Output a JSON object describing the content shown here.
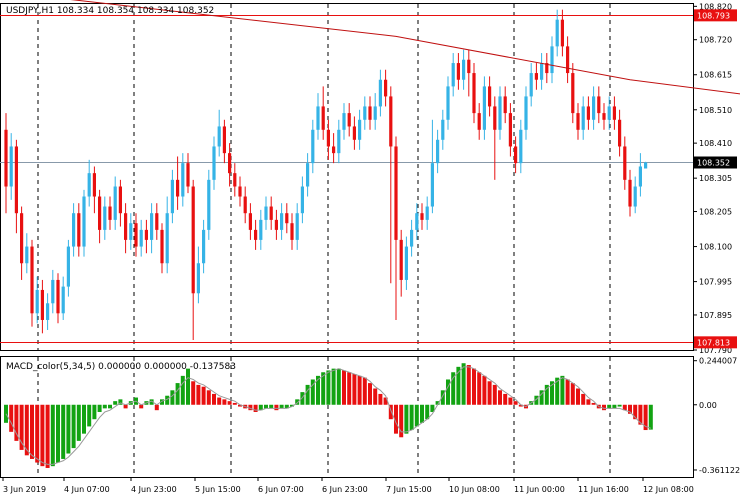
{
  "header": {
    "symbol_line": "USDJPY,H1  108.334 108.354 108.334 108.352"
  },
  "indicator": {
    "label": "MACD_color(5,34,5) 0.000000 0.000000 -0.137583"
  },
  "colors": {
    "bull": "#35B3E6",
    "bear": "#E81010",
    "macd_pos": "#12A312",
    "macd_neg": "#E81010",
    "signal": "#9A9A9A",
    "level_line": "#E81010",
    "ma_line": "#C01010",
    "current_price_line": "#8899AA",
    "grid": "#000000",
    "price_label_bg": "#E81010",
    "current_label_bg": "#000000"
  },
  "chart_data": [
    {
      "type": "candlestick",
      "title": "",
      "ylim": [
        107.79,
        108.83
      ],
      "y_ticks": [
        "108.820",
        "108.720",
        "108.615",
        "108.510",
        "108.410",
        "108.305",
        "108.205",
        "108.100",
        "107.995",
        "107.895",
        "107.790"
      ],
      "x_ticks": [
        "3 Jun 2019",
        "4 Jun 07:00",
        "4 Jun 23:00",
        "5 Jun 15:00",
        "6 Jun 07:00",
        "6 Jun 23:00",
        "7 Jun 15:00",
        "10 Jun 08:00",
        "11 Jun 00:00",
        "11 Jun 16:00",
        "12 Jun 08:00"
      ],
      "horizontal_levels": [
        {
          "value": 108.793,
          "label": "108.793"
        },
        {
          "value": 107.813,
          "label": "107.813"
        }
      ],
      "current_price": {
        "value": 108.352,
        "label": "108.352"
      },
      "moving_average": [
        [
          7,
          108.85
        ],
        [
          75,
          108.73
        ],
        [
          120,
          108.6
        ],
        [
          150,
          108.54
        ],
        [
          170,
          108.45
        ],
        [
          185,
          108.37
        ],
        [
          191,
          108.35
        ]
      ],
      "candles": [
        [
          108.45,
          108.28,
          108.5,
          108.2
        ],
        [
          108.28,
          108.4,
          108.44,
          108.24
        ],
        [
          108.4,
          108.2,
          108.42,
          108.14
        ],
        [
          108.2,
          108.05,
          108.22,
          108.0
        ],
        [
          108.05,
          108.1,
          108.14,
          108.02
        ],
        [
          108.1,
          107.9,
          108.12,
          107.86
        ],
        [
          107.9,
          107.97,
          108.01,
          107.87
        ],
        [
          107.97,
          107.88,
          108.0,
          107.84
        ],
        [
          107.88,
          107.93,
          107.96,
          107.85
        ],
        [
          107.93,
          108.0,
          108.03,
          107.9
        ],
        [
          108.0,
          107.9,
          108.02,
          107.87
        ],
        [
          107.9,
          107.98,
          108.01,
          107.88
        ],
        [
          107.98,
          108.1,
          108.12,
          107.95
        ],
        [
          108.1,
          108.2,
          108.23,
          108.07
        ],
        [
          108.2,
          108.1,
          108.23,
          108.07
        ],
        [
          108.1,
          108.25,
          108.27,
          108.07
        ],
        [
          108.25,
          108.32,
          108.36,
          108.22
        ],
        [
          108.32,
          108.25,
          108.34,
          108.2
        ],
        [
          108.25,
          108.15,
          108.27,
          108.11
        ],
        [
          108.15,
          108.22,
          108.25,
          108.12
        ],
        [
          108.22,
          108.18,
          108.25,
          108.15
        ],
        [
          108.18,
          108.28,
          108.31,
          108.15
        ],
        [
          108.28,
          108.2,
          108.3,
          108.16
        ],
        [
          108.2,
          108.12,
          108.23,
          108.08
        ],
        [
          108.12,
          108.17,
          108.2,
          108.09
        ],
        [
          108.17,
          108.1,
          108.2,
          108.07
        ],
        [
          108.1,
          108.15,
          108.18,
          108.07
        ],
        [
          108.15,
          108.12,
          108.18,
          108.08
        ],
        [
          108.12,
          108.2,
          108.23,
          108.08
        ],
        [
          108.2,
          108.15,
          108.23,
          108.12
        ],
        [
          108.15,
          108.05,
          108.17,
          108.02
        ],
        [
          108.05,
          108.2,
          108.25,
          108.02
        ],
        [
          108.2,
          108.3,
          108.33,
          108.17
        ],
        [
          108.3,
          108.25,
          108.37,
          108.21
        ],
        [
          108.25,
          108.35,
          108.38,
          108.22
        ],
        [
          108.35,
          108.28,
          108.38,
          108.26
        ],
        [
          108.28,
          107.96,
          108.3,
          107.82
        ],
        [
          107.96,
          108.05,
          108.1,
          107.93
        ],
        [
          108.05,
          108.15,
          108.18,
          108.02
        ],
        [
          108.15,
          108.3,
          108.33,
          108.12
        ],
        [
          108.3,
          108.4,
          108.43,
          108.27
        ],
        [
          108.4,
          108.46,
          108.51,
          108.37
        ],
        [
          108.46,
          108.38,
          108.48,
          108.35
        ],
        [
          108.38,
          108.32,
          108.41,
          108.28
        ],
        [
          108.32,
          108.28,
          108.35,
          108.25
        ],
        [
          108.28,
          108.25,
          108.31,
          108.22
        ],
        [
          108.25,
          108.2,
          108.28,
          108.17
        ],
        [
          108.2,
          108.15,
          108.23,
          108.12
        ],
        [
          108.15,
          108.12,
          108.18,
          108.09
        ],
        [
          108.12,
          108.18,
          108.21,
          108.09
        ],
        [
          108.18,
          108.22,
          108.25,
          108.15
        ],
        [
          108.22,
          108.18,
          108.25,
          108.15
        ],
        [
          108.18,
          108.15,
          108.21,
          108.12
        ],
        [
          108.15,
          108.2,
          108.23,
          108.12
        ],
        [
          108.2,
          108.17,
          108.23,
          108.14
        ],
        [
          108.17,
          108.12,
          108.2,
          108.09
        ],
        [
          108.12,
          108.2,
          108.23,
          108.09
        ],
        [
          108.2,
          108.28,
          108.31,
          108.17
        ],
        [
          108.28,
          108.35,
          108.38,
          108.25
        ],
        [
          108.35,
          108.45,
          108.48,
          108.32
        ],
        [
          108.45,
          108.52,
          108.56,
          108.42
        ],
        [
          108.52,
          108.45,
          108.58,
          108.42
        ],
        [
          108.45,
          108.4,
          108.48,
          108.36
        ],
        [
          108.4,
          108.38,
          108.44,
          108.35
        ],
        [
          108.38,
          108.45,
          108.48,
          108.35
        ],
        [
          108.45,
          108.5,
          108.53,
          108.42
        ],
        [
          108.5,
          108.46,
          108.53,
          108.43
        ],
        [
          108.46,
          108.42,
          108.49,
          108.39
        ],
        [
          108.42,
          108.48,
          108.51,
          108.39
        ],
        [
          108.48,
          108.52,
          108.55,
          108.45
        ],
        [
          108.52,
          108.48,
          108.55,
          108.45
        ],
        [
          108.48,
          108.52,
          108.56,
          108.45
        ],
        [
          108.52,
          108.6,
          108.63,
          108.49
        ],
        [
          108.6,
          108.55,
          108.63,
          108.52
        ],
        [
          108.55,
          108.4,
          108.58,
          107.99
        ],
        [
          108.4,
          108.12,
          108.43,
          107.88
        ],
        [
          108.12,
          108.0,
          108.15,
          107.95
        ],
        [
          108.0,
          108.1,
          108.13,
          107.97
        ],
        [
          108.1,
          108.15,
          108.18,
          108.07
        ],
        [
          108.15,
          108.2,
          108.23,
          108.12
        ],
        [
          108.2,
          108.18,
          108.23,
          108.15
        ],
        [
          108.18,
          108.22,
          108.25,
          108.15
        ],
        [
          108.22,
          108.35,
          108.48,
          108.2
        ],
        [
          108.35,
          108.42,
          108.45,
          108.32
        ],
        [
          108.42,
          108.48,
          108.51,
          108.39
        ],
        [
          108.48,
          108.58,
          108.61,
          108.45
        ],
        [
          108.58,
          108.65,
          108.68,
          108.55
        ],
        [
          108.65,
          108.6,
          108.68,
          108.57
        ],
        [
          108.6,
          108.66,
          108.69,
          108.57
        ],
        [
          108.66,
          108.62,
          108.69,
          108.55
        ],
        [
          108.62,
          108.5,
          108.65,
          108.47
        ],
        [
          108.5,
          108.45,
          108.53,
          108.42
        ],
        [
          108.45,
          108.58,
          108.61,
          108.42
        ],
        [
          108.58,
          108.52,
          108.61,
          108.49
        ],
        [
          108.52,
          108.45,
          108.55,
          108.3
        ],
        [
          108.45,
          108.55,
          108.58,
          108.42
        ],
        [
          108.55,
          108.5,
          108.58,
          108.47
        ],
        [
          108.5,
          108.4,
          108.53,
          108.37
        ],
        [
          108.4,
          108.35,
          108.43,
          108.32
        ],
        [
          108.35,
          108.45,
          108.48,
          108.32
        ],
        [
          108.45,
          108.55,
          108.58,
          108.42
        ],
        [
          108.55,
          108.62,
          108.65,
          108.52
        ],
        [
          108.62,
          108.6,
          108.65,
          108.57
        ],
        [
          108.6,
          108.65,
          108.68,
          108.57
        ],
        [
          108.65,
          108.62,
          108.68,
          108.59
        ],
        [
          108.62,
          108.7,
          108.73,
          108.59
        ],
        [
          108.7,
          108.78,
          108.81,
          108.67
        ],
        [
          108.78,
          108.7,
          108.81,
          108.67
        ],
        [
          108.7,
          108.62,
          108.73,
          108.59
        ],
        [
          108.62,
          108.5,
          108.65,
          108.47
        ],
        [
          108.5,
          108.45,
          108.53,
          108.42
        ],
        [
          108.45,
          108.52,
          108.55,
          108.42
        ],
        [
          108.52,
          108.48,
          108.55,
          108.45
        ],
        [
          108.48,
          108.55,
          108.58,
          108.45
        ],
        [
          108.55,
          108.5,
          108.58,
          108.47
        ],
        [
          108.5,
          108.48,
          108.53,
          108.45
        ],
        [
          108.48,
          108.52,
          108.55,
          108.45
        ],
        [
          108.52,
          108.48,
          108.55,
          108.45
        ],
        [
          108.48,
          108.4,
          108.51,
          108.37
        ],
        [
          108.4,
          108.3,
          108.43,
          108.27
        ],
        [
          108.3,
          108.22,
          108.33,
          108.19
        ],
        [
          108.22,
          108.28,
          108.31,
          108.2
        ],
        [
          108.28,
          108.34,
          108.38,
          108.25
        ],
        [
          108.334,
          108.352,
          108.354,
          108.334
        ]
      ]
    },
    {
      "type": "bar",
      "title": "MACD_color(5,34,5)",
      "ylim": [
        -0.4,
        0.27
      ],
      "y_ticks": [
        "0.244007",
        "0.00",
        "-0.361122"
      ],
      "values": [
        -0.1,
        -0.15,
        -0.2,
        -0.25,
        -0.28,
        -0.3,
        -0.32,
        -0.34,
        -0.35,
        -0.34,
        -0.32,
        -0.3,
        -0.27,
        -0.24,
        -0.2,
        -0.16,
        -0.12,
        -0.08,
        -0.04,
        -0.02,
        -0.02,
        0.02,
        0.03,
        -0.02,
        0.02,
        0.04,
        -0.02,
        0.02,
        0.03,
        -0.03,
        0.03,
        0.05,
        0.08,
        0.12,
        0.16,
        0.2,
        0.13,
        0.11,
        0.1,
        0.08,
        0.06,
        0.04,
        0.03,
        0.02,
        0.01,
        -0.01,
        -0.02,
        -0.03,
        -0.04,
        -0.03,
        -0.02,
        -0.02,
        -0.03,
        -0.02,
        -0.02,
        -0.01,
        0.03,
        0.07,
        0.11,
        0.14,
        0.16,
        0.18,
        0.19,
        0.2,
        0.2,
        0.19,
        0.18,
        0.17,
        0.16,
        0.15,
        0.12,
        0.09,
        0.06,
        0.04,
        -0.08,
        -0.16,
        -0.18,
        -0.16,
        -0.14,
        -0.12,
        -0.1,
        -0.08,
        -0.04,
        0.02,
        0.08,
        0.14,
        0.18,
        0.21,
        0.23,
        0.22,
        0.2,
        0.18,
        0.16,
        0.13,
        0.11,
        0.08,
        0.06,
        0.04,
        0.02,
        -0.01,
        -0.02,
        0.02,
        0.05,
        0.08,
        0.11,
        0.13,
        0.15,
        0.16,
        0.14,
        0.12,
        0.09,
        0.06,
        0.03,
        0.01,
        -0.02,
        -0.03,
        -0.02,
        -0.02,
        -0.01,
        -0.03,
        -0.05,
        -0.08,
        -0.11,
        -0.14,
        -0.137583
      ],
      "signal": [
        -0.05,
        -0.1,
        -0.16,
        -0.21,
        -0.25,
        -0.28,
        -0.3,
        -0.32,
        -0.33,
        -0.33,
        -0.32,
        -0.31,
        -0.29,
        -0.26,
        -0.23,
        -0.19,
        -0.15,
        -0.11,
        -0.07,
        -0.04,
        -0.03,
        -0.01,
        0.01,
        0.0,
        0.01,
        0.02,
        0.0,
        0.01,
        0.02,
        0.0,
        0.02,
        0.03,
        0.05,
        0.08,
        0.12,
        0.15,
        0.14,
        0.12,
        0.11,
        0.09,
        0.07,
        0.05,
        0.04,
        0.03,
        0.02,
        0.0,
        -0.01,
        -0.02,
        -0.03,
        -0.03,
        -0.02,
        -0.02,
        -0.02,
        -0.02,
        -0.02,
        -0.01,
        0.01,
        0.04,
        0.08,
        0.11,
        0.14,
        0.16,
        0.18,
        0.19,
        0.2,
        0.19,
        0.18,
        0.17,
        0.16,
        0.15,
        0.13,
        0.1,
        0.08,
        0.05,
        -0.03,
        -0.1,
        -0.15,
        -0.15,
        -0.14,
        -0.12,
        -0.1,
        -0.08,
        -0.05,
        0.0,
        0.05,
        0.1,
        0.15,
        0.18,
        0.21,
        0.21,
        0.2,
        0.18,
        0.16,
        0.14,
        0.12,
        0.09,
        0.07,
        0.05,
        0.03,
        0.0,
        -0.01,
        0.01,
        0.03,
        0.06,
        0.09,
        0.11,
        0.13,
        0.15,
        0.14,
        0.12,
        0.1,
        0.07,
        0.04,
        0.02,
        -0.01,
        -0.02,
        -0.02,
        -0.02,
        -0.02,
        -0.03,
        -0.04,
        -0.07,
        -0.1,
        -0.12,
        -0.13
      ]
    }
  ]
}
